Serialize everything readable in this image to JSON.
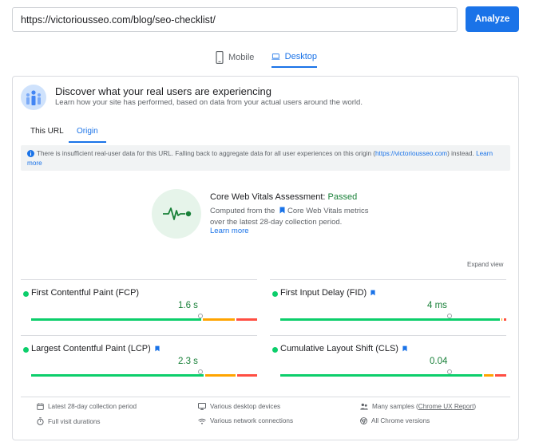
{
  "url_bar": {
    "value": "https://victoriousseo.com/blog/seo-checklist/",
    "analyze_label": "Analyze"
  },
  "device_tabs": [
    {
      "label": "Mobile",
      "icon": "smartphone-icon",
      "active": false
    },
    {
      "label": "Desktop",
      "icon": "laptop-icon",
      "active": true
    }
  ],
  "panel": {
    "title": "Discover what your real users are experiencing",
    "subtitle": "Learn how your site has performed, based on data from your actual users around the world.",
    "tabs": [
      {
        "label": "This URL",
        "active": false
      },
      {
        "label": "Origin",
        "active": true
      }
    ],
    "notice": {
      "text": "There is insufficient real-user data for this URL. Falling back to aggregate data for all user experiences on this origin (",
      "origin_link": "https://victoriousseo.com",
      "text_after": ") instead.",
      "learn_more": "Learn more"
    },
    "assessment": {
      "title_prefix": "Core Web Vitals Assessment: ",
      "status": "Passed",
      "desc_line1_before": "Computed from the",
      "desc_line1_after": "Core Web Vitals metrics",
      "desc_line2": "over the latest 28-day collection period.",
      "learn_more": "Learn more"
    },
    "expand_view": "Expand view",
    "metrics": [
      {
        "name": "First Contentful Paint (FCP)",
        "value": "1.6 s",
        "core_vital": false,
        "good_pct": 0.76,
        "avg_pct": 0.15,
        "marker_pct": 0.75
      },
      {
        "name": "First Input Delay (FID)",
        "value": "4 ms",
        "core_vital": true,
        "good_pct": 0.98,
        "avg_pct": 0.01,
        "marker_pct": 0.75
      },
      {
        "name": "Largest Contentful Paint (LCP)",
        "value": "2.3 s",
        "core_vital": true,
        "good_pct": 0.77,
        "avg_pct": 0.14,
        "marker_pct": 0.75
      },
      {
        "name": "Cumulative Layout Shift (CLS)",
        "value": "0.04",
        "core_vital": true,
        "good_pct": 0.9,
        "avg_pct": 0.05,
        "marker_pct": 0.75
      }
    ],
    "footer": [
      {
        "icon": "calendar-icon",
        "text": "Latest 28-day collection period"
      },
      {
        "icon": "monitor-icon",
        "text": "Various desktop devices"
      },
      {
        "icon": "users-icon",
        "text": "Many samples (",
        "link": "Chrome UX Report",
        "text_after": ")"
      },
      {
        "icon": "stopwatch-icon",
        "text": "Full visit durations"
      },
      {
        "icon": "wifi-icon",
        "text": "Various network connections"
      },
      {
        "icon": "chrome-icon",
        "text": "All Chrome versions"
      }
    ]
  },
  "colors": {
    "accent": "#1a73e8",
    "good": "#0cce6b",
    "average": "#ffa400",
    "poor": "#ff4e42",
    "pass_text": "#188038"
  }
}
